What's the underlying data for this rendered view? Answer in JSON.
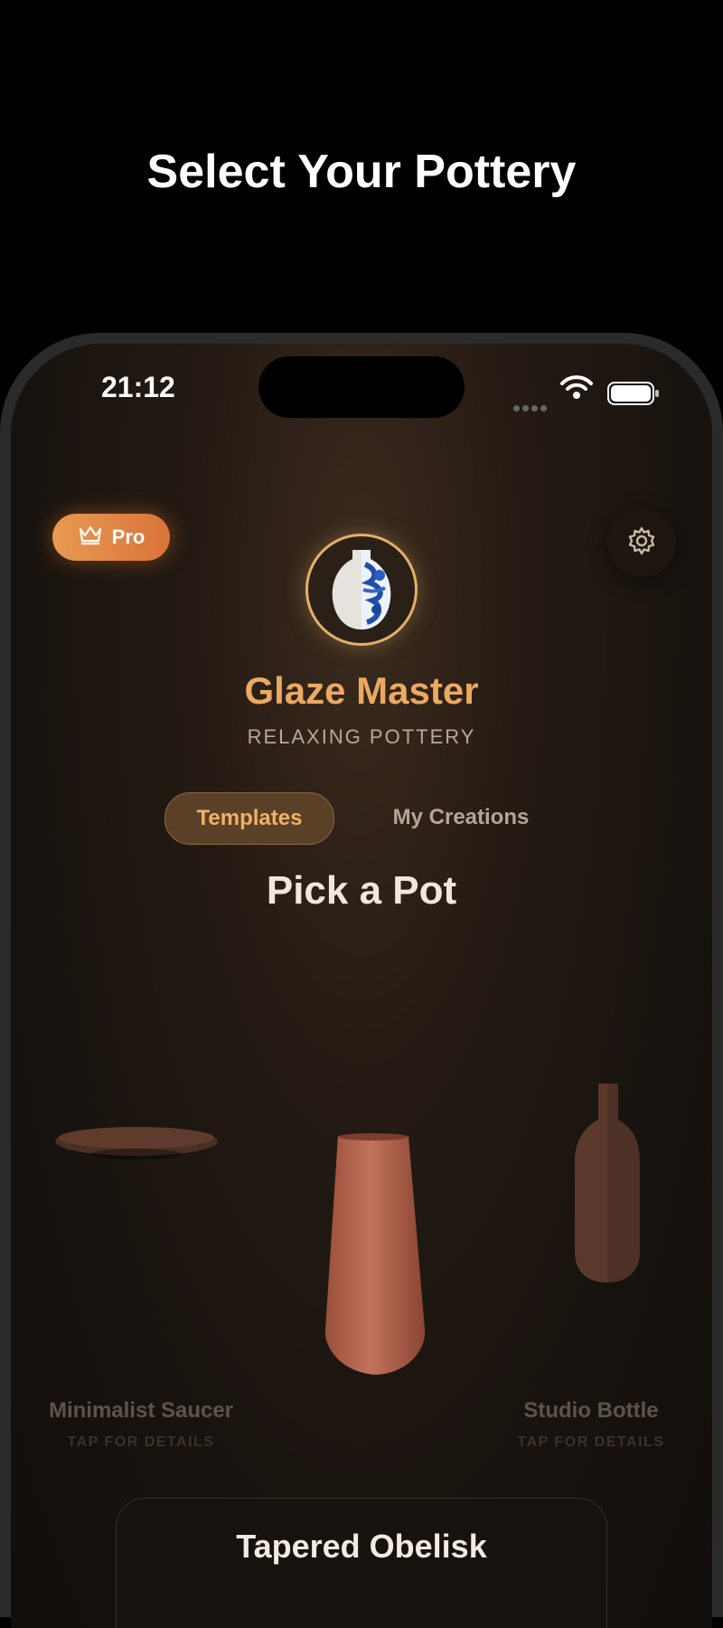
{
  "headline": "Select Your Pottery",
  "status": {
    "time": "21:12"
  },
  "pro_badge": {
    "label": "Pro"
  },
  "app": {
    "title": "Glaze Master",
    "subtitle": "RELAXING POTTERY"
  },
  "tabs": [
    {
      "label": "Templates",
      "active": true
    },
    {
      "label": "My Creations",
      "active": false
    }
  ],
  "section_title": "Pick a Pot",
  "pots": [
    {
      "name": "Minimalist Saucer",
      "hint": "TAP FOR DETAILS"
    },
    {
      "name": "Tapered Obelisk",
      "hint": ""
    },
    {
      "name": "Studio Bottle",
      "hint": "TAP FOR DETAILS"
    }
  ],
  "selected_card": {
    "title": "Tapered Obelisk"
  },
  "colors": {
    "accent": "#eca962",
    "pro": "#e2853f",
    "clay": "#b8634a"
  }
}
